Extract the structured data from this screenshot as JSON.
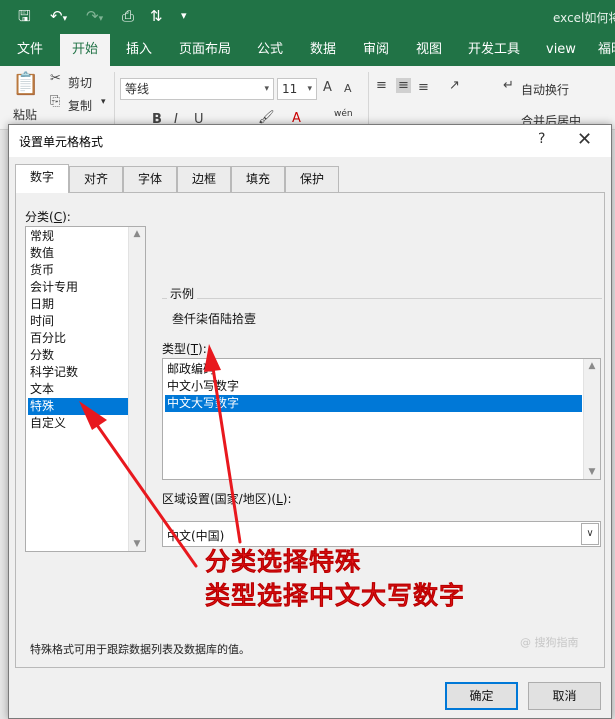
{
  "excel": {
    "doc_title": "excel如何将",
    "ribbon_tabs": [
      {
        "label": "文件",
        "active": false
      },
      {
        "label": "开始",
        "active": true
      },
      {
        "label": "插入",
        "active": false
      },
      {
        "label": "页面布局",
        "active": false
      },
      {
        "label": "公式",
        "active": false
      },
      {
        "label": "数据",
        "active": false
      },
      {
        "label": "审阅",
        "active": false
      },
      {
        "label": "视图",
        "active": false
      },
      {
        "label": "开发工具",
        "active": false
      },
      {
        "label": "view",
        "active": false
      },
      {
        "label": "福昕",
        "active": false
      }
    ],
    "ribbon": {
      "paste": "粘贴",
      "cut": "剪切",
      "copy": "复制",
      "font_name": "等线",
      "font_size": "11",
      "wrap_text": "自动换行",
      "merge_center": "合并后居中",
      "wen": "wén",
      "bold": "B",
      "italic": "I",
      "underline": "U",
      "grow_font": "A",
      "shrink_font": "A"
    }
  },
  "dialog": {
    "title": "设置单元格格式",
    "help": "?",
    "close": "✕",
    "tabs": [
      {
        "label": "数字",
        "active": true
      },
      {
        "label": "对齐",
        "active": false
      },
      {
        "label": "字体",
        "active": false
      },
      {
        "label": "边框",
        "active": false
      },
      {
        "label": "填充",
        "active": false
      },
      {
        "label": "保护",
        "active": false
      }
    ],
    "category_label": "分类",
    "category_key": "C",
    "categories": [
      {
        "label": "常规",
        "selected": false
      },
      {
        "label": "数值",
        "selected": false
      },
      {
        "label": "货币",
        "selected": false
      },
      {
        "label": "会计专用",
        "selected": false
      },
      {
        "label": "日期",
        "selected": false
      },
      {
        "label": "时间",
        "selected": false
      },
      {
        "label": "百分比",
        "selected": false
      },
      {
        "label": "分数",
        "selected": false
      },
      {
        "label": "科学记数",
        "selected": false
      },
      {
        "label": "文本",
        "selected": false
      },
      {
        "label": "特殊",
        "selected": true
      },
      {
        "label": "自定义",
        "selected": false
      }
    ],
    "sample_label": "示例",
    "sample_value": "叁仟柒佰陆拾壹",
    "type_label": "类型",
    "type_key": "T",
    "types": [
      {
        "label": "邮政编码",
        "selected": false
      },
      {
        "label": "中文小写数字",
        "selected": false
      },
      {
        "label": "中文大写数字",
        "selected": true
      }
    ],
    "locale_label_pre": "区域设置(国家/地区)(",
    "locale_key": "L",
    "locale_label_post": "):",
    "locale_value": "中文(中国)",
    "description": "特殊格式可用于跟踪数据列表及数据库的值。",
    "ok": "确定",
    "cancel": "取消"
  },
  "annotation": {
    "line1": "分类选择特殊",
    "line2": "类型选择中文大写数字",
    "color": "#e8181e"
  },
  "watermark": "@ 搜狗指南"
}
